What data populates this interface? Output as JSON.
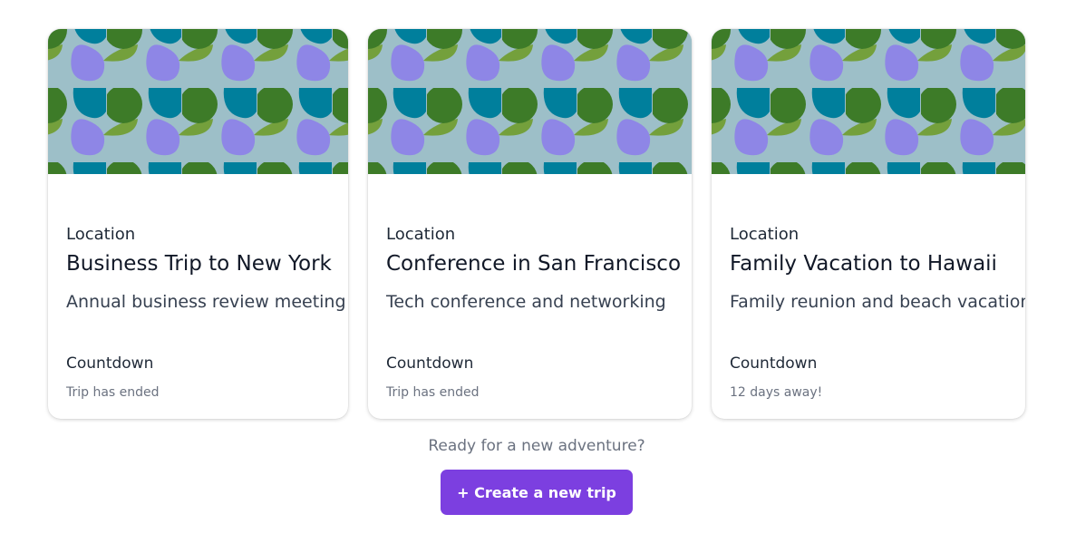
{
  "trips": [
    {
      "location_label": "Location",
      "title": "Business Trip to New York",
      "description": "Annual business review meeting",
      "countdown_label": "Countdown",
      "countdown_value": "Trip has ended"
    },
    {
      "location_label": "Location",
      "title": "Conference in San Francisco",
      "description": "Tech conference and networking",
      "countdown_label": "Countdown",
      "countdown_value": "Trip has ended"
    },
    {
      "location_label": "Location",
      "title": "Family Vacation to Hawaii",
      "description": "Family reunion and beach vacation",
      "countdown_label": "Countdown",
      "countdown_value": "12 days away!"
    }
  ],
  "footer": {
    "prompt": "Ready for a new adventure?",
    "create_button_label": "+ Create a new trip"
  },
  "colors": {
    "accent": "#7c3fe0",
    "banner_background": "#9dbfc8",
    "shape_dark_green": "#3d7b28",
    "shape_light_green": "#74a03c",
    "shape_teal": "#007f9c",
    "shape_purple": "#8e86e6"
  }
}
